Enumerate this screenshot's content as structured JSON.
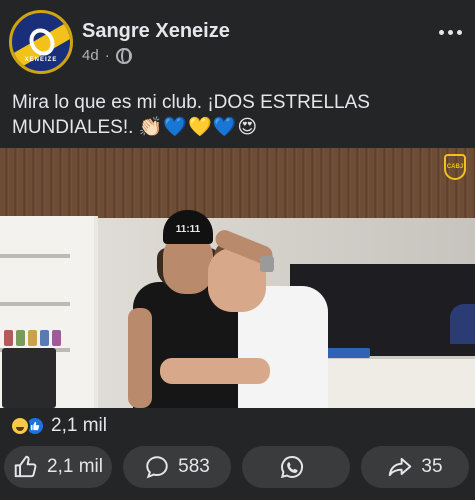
{
  "header": {
    "page_name": "Sangre Xeneize",
    "time": "4d",
    "separator": "·",
    "avatar_text": "XENEIZE"
  },
  "post": {
    "caption_text": "Mira lo que es mi club. ¡DOS ESTRELLAS MUNDIALES!.",
    "caption_emojis": "👏🏻💙💛💙😍"
  },
  "video": {
    "cap_text": "11:11",
    "watermark": "CABJ"
  },
  "reactions": {
    "count": "2,1 mil"
  },
  "actions": {
    "like_count": "2,1 mil",
    "comment_count": "583",
    "whatsapp_count": "",
    "share_count": "35"
  },
  "colors": {
    "background": "#242526",
    "button_bg": "#3a3b3c",
    "text": "#e4e6eb",
    "secondary_text": "#b0b3b8",
    "like_blue": "#1b74e4",
    "boca_blue": "#1a2f7a",
    "boca_yellow": "#f2c21a"
  },
  "icons": {
    "more": "more-options-icon",
    "audience": "globe-icon",
    "like": "thumbs-up-icon",
    "comment": "comment-bubble-icon",
    "whatsapp": "whatsapp-icon",
    "share": "share-arrow-icon"
  }
}
